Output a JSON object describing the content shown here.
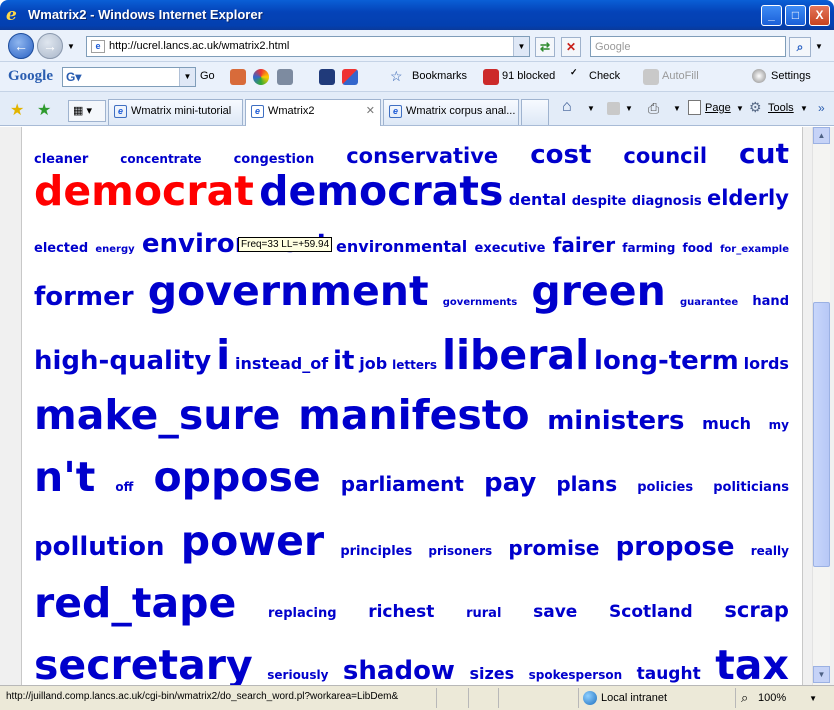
{
  "window": {
    "title": "Wmatrix2 - Windows Internet Explorer",
    "minimize": "_",
    "maximize": "□",
    "close": "X"
  },
  "address": {
    "url": "http://ucrel.lancs.ac.uk/wmatrix2.html",
    "search_placeholder": "Google"
  },
  "google_toolbar": {
    "logo": "Google",
    "go": "Go",
    "bookmarks": "Bookmarks",
    "blocked": "91 blocked",
    "check": "Check",
    "autofill": "AutoFill",
    "settings": "Settings"
  },
  "tabs": [
    {
      "label": "Wmatrix mini-tutorial"
    },
    {
      "label": "Wmatrix2"
    },
    {
      "label": "Wmatrix corpus anal..."
    }
  ],
  "command_bar": {
    "page": "Page",
    "tools": "Tools"
  },
  "cloud": {
    "words": [
      "cleaner",
      "concentrate",
      "congestion",
      "conservative",
      "cost",
      "council",
      "cut",
      "democrat",
      "democrats",
      "dental",
      "despite",
      "diagnosis",
      "elderly",
      "elected",
      "energy",
      "environment",
      "environmental",
      "executive",
      "fairer",
      "farming",
      "food",
      "for_example",
      "former",
      "government",
      "governments",
      "green",
      "guarantee",
      "hand",
      "high-quality",
      "i",
      "instead_of",
      "it",
      "job",
      "letters",
      "liberal",
      "long-term",
      "lords",
      "make_sure",
      "manifesto",
      "ministers",
      "much",
      "my",
      "n't",
      "off",
      "oppose",
      "parliament",
      "pay",
      "plans",
      "policies",
      "politicians",
      "pollution",
      "power",
      "principles",
      "prisoners",
      "promise",
      "propose",
      "really",
      "red_tape",
      "replacing",
      "richest",
      "rural",
      "save",
      "Scotland",
      "scrap",
      "secretary",
      "seriously",
      "shadow",
      "sizes",
      "spokesperson",
      "taught",
      "tax"
    ],
    "tooltip": "Freq=33 LL=+59.94"
  },
  "status": {
    "url": "http://juilland.comp.lancs.ac.uk/cgi-bin/wmatrix2/do_search_word.pl?workarea=LibDem&",
    "zone": "Local intranet",
    "zoom": "100%"
  }
}
